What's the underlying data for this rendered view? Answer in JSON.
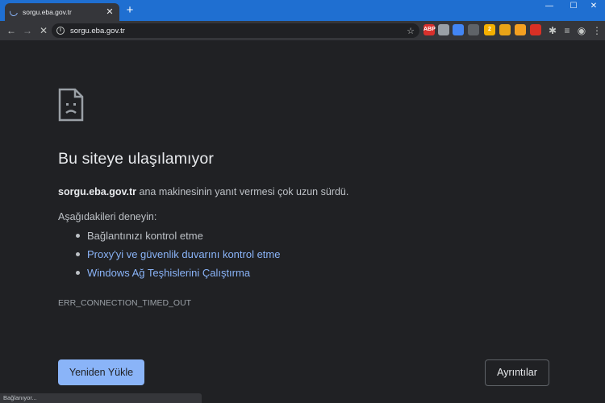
{
  "tab": {
    "title": "sorgu.eba.gov.tr"
  },
  "window_controls": {
    "minimize": "—",
    "maximize": "☐",
    "close": "✕"
  },
  "toolbar": {
    "url": "sorgu.eba.gov.tr"
  },
  "extensions": [
    {
      "label": "ABP",
      "color": "#d9302c"
    },
    {
      "label": "",
      "color": "#9aa0a6"
    },
    {
      "label": "",
      "color": "#4285f4"
    },
    {
      "label": "",
      "color": "#5f6368"
    },
    {
      "label": "2",
      "color": "#f5b000"
    },
    {
      "label": "",
      "color": "#e8a317"
    },
    {
      "label": "",
      "color": "#f4a021"
    },
    {
      "label": "",
      "color": "#d93025"
    }
  ],
  "error": {
    "heading": "Bu siteye ulaşılamıyor",
    "host": "sorgu.eba.gov.tr",
    "message": " ana makinesinin yanıt vermesi çok uzun sürdü.",
    "try_label": "Aşağıdakileri deneyin:",
    "suggestions": [
      {
        "text": "Bağlantınızı kontrol etme",
        "link": false
      },
      {
        "text": "Proxy'yi ve güvenlik duvarını kontrol etme",
        "link": true
      },
      {
        "text": "Windows Ağ Teşhislerini Çalıştırma",
        "link": true
      }
    ],
    "code": "ERR_CONNECTION_TIMED_OUT",
    "reload_label": "Yeniden Yükle",
    "details_label": "Ayrıntılar"
  },
  "status": {
    "text": "Bağlanıyor..."
  }
}
